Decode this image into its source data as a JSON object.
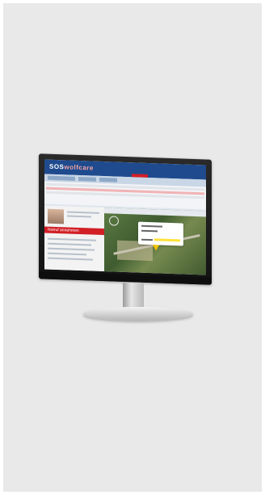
{
  "screen": {
    "logo_text": "SOS",
    "logo_suffix": "wolfcare",
    "alarm_label": "Notruf annehmen"
  },
  "colors": {
    "header_blue": "#1f4b8e",
    "alarm_red": "#d21f26",
    "highlight_yellow": "#ffe23b"
  }
}
